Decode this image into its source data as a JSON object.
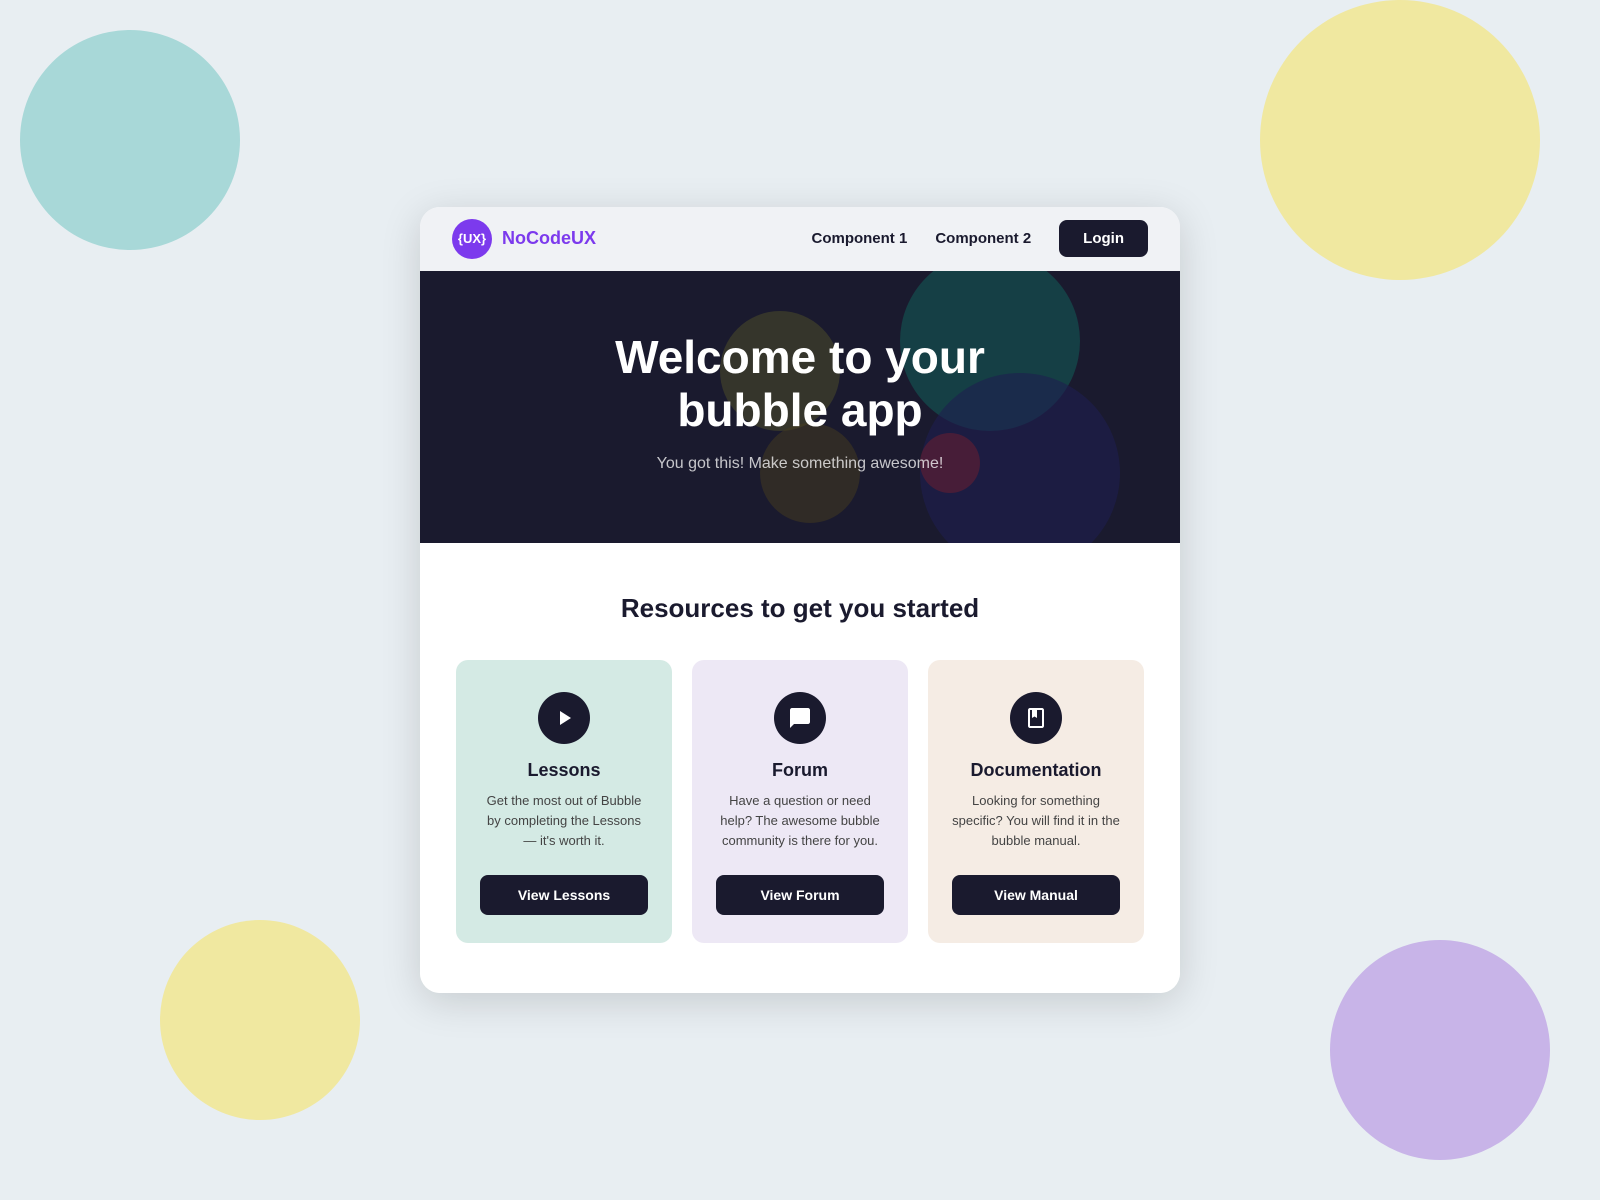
{
  "background": {
    "color": "#e8eef2"
  },
  "navbar": {
    "brand_logo_text": "{UX}",
    "brand_name_prefix": "NoCode",
    "brand_name_suffix": "UX",
    "nav1_label": "Component 1",
    "nav2_label": "Component 2",
    "login_label": "Login"
  },
  "hero": {
    "title_line1": "Welcome to your",
    "title_line2": "bubble app",
    "subtitle": "You got this! Make something awesome!"
  },
  "resources": {
    "section_title": "Resources to get you started",
    "cards": [
      {
        "id": "lessons",
        "title": "Lessons",
        "description": "Get the most out of Bubble by completing the Lessons — it's worth it.",
        "button_label": "View Lessons",
        "color_class": "rc-green"
      },
      {
        "id": "forum",
        "title": "Forum",
        "description": "Have a question or need help? The awesome bubble community is there for you.",
        "button_label": "View Forum",
        "color_class": "rc-purple"
      },
      {
        "id": "documentation",
        "title": "Documentation",
        "description": "Looking for something specific? You will find it in the bubble manual.",
        "button_label": "View Manual",
        "color_class": "rc-pink"
      }
    ]
  }
}
